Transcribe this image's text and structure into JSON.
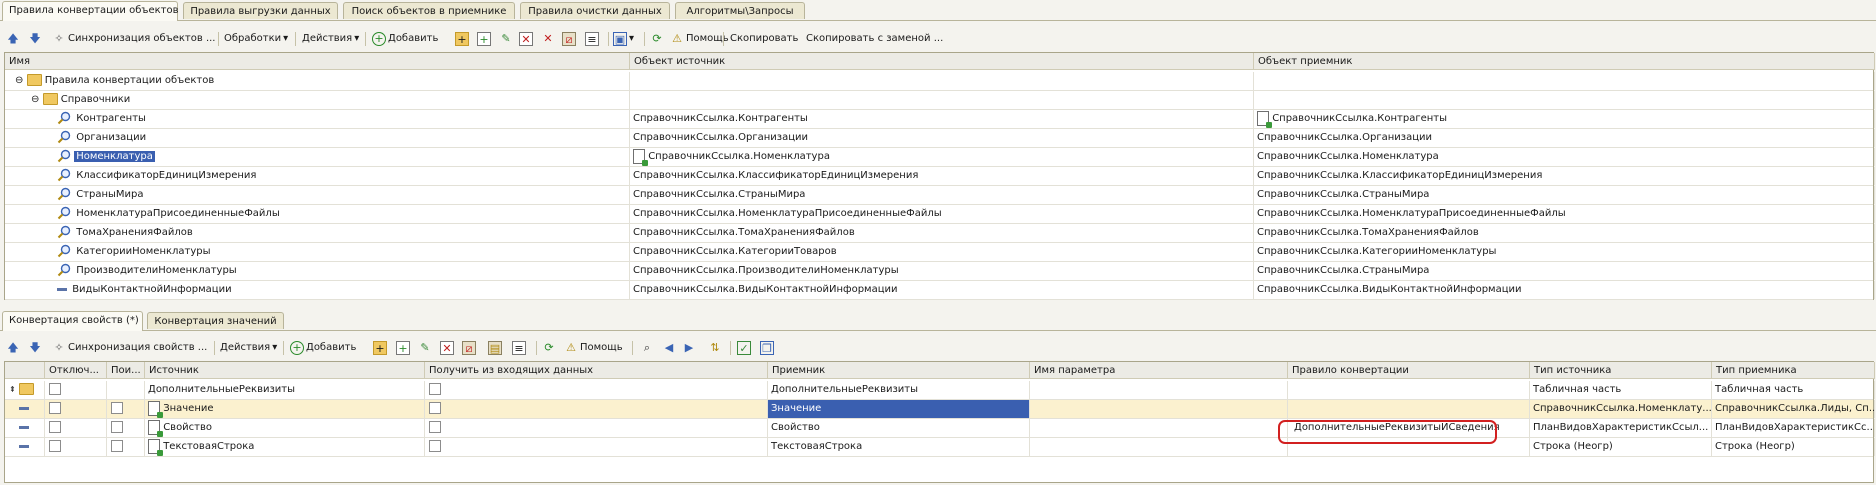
{
  "top_tabs": [
    "Правила конвертации объектов",
    "Правила выгрузки данных",
    "Поиск объектов в приемнике",
    "Правила очистки данных",
    "Алгоритмы\\Запросы"
  ],
  "toolbar1": {
    "sync": "Синхронизация объектов ...",
    "processing": "Обработки",
    "actions": "Действия",
    "add": "Добавить",
    "help": "Помощь",
    "copy": "Скопировать",
    "copy_replace": "Скопировать с заменой ..."
  },
  "grid1": {
    "headers": [
      "Имя",
      "Объект источник",
      "Объект приемник"
    ],
    "group_root": "Правила конвертации объектов",
    "group_sub": "Справочники",
    "rows": [
      {
        "name": "Контрагенты",
        "source": "СправочникСсылка.Контрагенты",
        "target": "СправочникСсылка.Контрагенты",
        "icon": "magnifier-icon"
      },
      {
        "name": "Организации",
        "source": "СправочникСсылка.Организации",
        "target": "СправочникСсылка.Организации",
        "icon": "magnifier-icon"
      },
      {
        "name": "Номенклатура",
        "source": "СправочникСсылка.Номенклатура",
        "target": "СправочникСсылка.Номенклатура",
        "icon": "magnifier-icon"
      },
      {
        "name": "КлассификаторЕдиницИзмерения",
        "source": "СправочникСсылка.КлассификаторЕдиницИзмерения",
        "target": "СправочникСсылка.КлассификаторЕдиницИзмерения",
        "icon": "magnifier-icon"
      },
      {
        "name": "СтраныМира",
        "source": "СправочникСсылка.СтраныМира",
        "target": "СправочникСсылка.СтраныМира",
        "icon": "magnifier-icon"
      },
      {
        "name": "НоменклатураПрисоединенныеФайлы",
        "source": "СправочникСсылка.НоменклатураПрисоединенныеФайлы",
        "target": "СправочникСсылка.НоменклатураПрисоединенныеФайлы",
        "icon": "magnifier-icon"
      },
      {
        "name": "ТомаХраненияФайлов",
        "source": "СправочникСсылка.ТомаХраненияФайлов",
        "target": "СправочникСсылка.ТомаХраненияФайлов",
        "icon": "magnifier-icon"
      },
      {
        "name": "КатегорииНоменклатуры",
        "source": "СправочникСсылка.КатегорииТоваров",
        "target": "СправочникСсылка.КатегорииНоменклатуры",
        "icon": "magnifier-icon"
      },
      {
        "name": "ПроизводителиНоменклатуры",
        "source": "СправочникСсылка.ПроизводителиНоменклатуры",
        "target": "СправочникСсылка.СтраныМира",
        "icon": "magnifier-icon"
      },
      {
        "name": "ВидыКонтактнойИнформации",
        "source": "СправочникСсылка.ВидыКонтактнойИнформации",
        "target": "СправочникСсылка.ВидыКонтактнойИнформации",
        "icon": "dash-icon"
      }
    ]
  },
  "bottom_tabs": [
    "Конвертация свойств (*)",
    "Конвертация значений"
  ],
  "toolbar2": {
    "sync": "Синхронизация свойств ...",
    "actions": "Действия",
    "add": "Добавить",
    "help": "Помощь"
  },
  "grid2": {
    "headers": [
      "Отключ...",
      "Пои...",
      "Источник",
      "Получить из входящих данных",
      "Приемник",
      "Имя параметра",
      "Правило конвертации",
      "Тип источника",
      "Тип приемника"
    ],
    "rows": [
      {
        "source": "ДополнительныеРеквизиты",
        "target": "ДополнительныеРеквизиты",
        "param": "",
        "rule": "",
        "src_type": "Табличная часть",
        "dst_type": "Табличная часть"
      },
      {
        "source": "Значение",
        "target": "Значение",
        "param": "",
        "rule": "",
        "src_type": "СправочникСсылка.Номенклату...",
        "dst_type": "СправочникСсылка.Лиды, Сп..."
      },
      {
        "source": "Свойство",
        "target": "Свойство",
        "param": "",
        "rule": "ДополнительныеРеквизитыИСведения",
        "src_type": "ПланВидовХарактеристикСсыл...",
        "dst_type": "ПланВидовХарактеристикСс..."
      },
      {
        "source": "ТекстоваяСтрока",
        "target": "ТекстоваяСтрока",
        "param": "",
        "rule": "",
        "src_type": "Строка (Неогр)",
        "dst_type": "Строка (Неогр)"
      }
    ]
  },
  "colors": {
    "selection": "#3a5fb0",
    "highlight_ring": "#d22020",
    "row_highlight": "#fbf1cf"
  }
}
